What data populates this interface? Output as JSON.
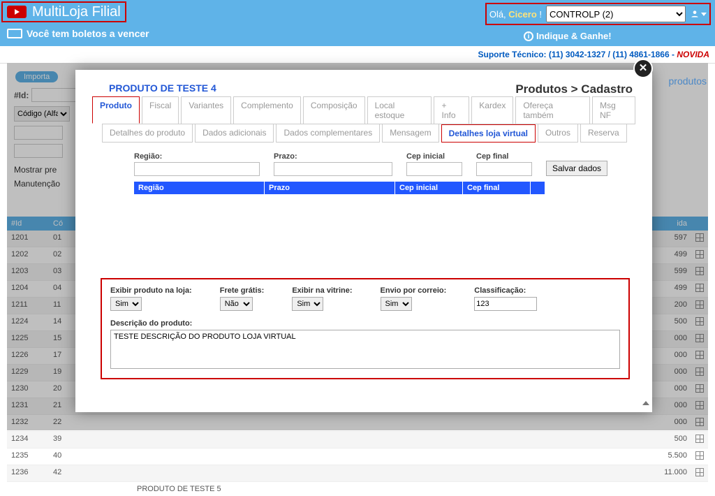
{
  "header": {
    "brand": "MultiLoja Filial",
    "boletos": "Você tem boletos a vencer",
    "greeting_prefix": "Olá, ",
    "greeting_name": "Cicero",
    "greeting_suffix": " !",
    "account_selected": "CONTROLP (2)",
    "indique": "Indique & Ganhe!",
    "support": "Suporte Técnico: (11) 3042-1327 / (11) 4861-1866 - ",
    "novidades": "NOVIDA"
  },
  "bg": {
    "import_btn": "Importa",
    "id_label": "#Id:",
    "codigo_placeholder": "Código (Alfa",
    "mostrar": "Mostrar pre",
    "manutencao": "Manutenção",
    "produtos_tag": "produtos",
    "table_headers": {
      "id": "#Id",
      "cod": "Có",
      "last": "ida"
    },
    "rows": [
      {
        "id": "1201",
        "cod": "01",
        "val": "597"
      },
      {
        "id": "1202",
        "cod": "02",
        "val": "499"
      },
      {
        "id": "1203",
        "cod": "03",
        "val": "599"
      },
      {
        "id": "1204",
        "cod": "04",
        "val": "499"
      },
      {
        "id": "1211",
        "cod": "11",
        "val": "200"
      },
      {
        "id": "1224",
        "cod": "14",
        "val": "500"
      },
      {
        "id": "1225",
        "cod": "15",
        "val": "000"
      },
      {
        "id": "1226",
        "cod": "17",
        "val": "000"
      },
      {
        "id": "1229",
        "cod": "19",
        "val": "000"
      },
      {
        "id": "1230",
        "cod": "20",
        "val": "000"
      },
      {
        "id": "1231",
        "cod": "21",
        "val": "000"
      },
      {
        "id": "1232",
        "cod": "22",
        "val": "000"
      },
      {
        "id": "1234",
        "cod": "39",
        "val": "500"
      },
      {
        "id": "1235",
        "cod": "40",
        "val": "5.500"
      },
      {
        "id": "1236",
        "cod": "42",
        "val": "11.000"
      }
    ],
    "last_prod_label": "PRODUTO DE TESTE 5"
  },
  "modal": {
    "title": "PRODUTO DE TESTE 4",
    "breadcrumb": "Produtos > Cadastro",
    "tabs": [
      "Produto",
      "Fiscal",
      "Variantes",
      "Complemento",
      "Composição",
      "Local estoque",
      "+ Info",
      "Kardex",
      "Ofereça também",
      "Msg NF"
    ],
    "subtabs": [
      "Detalhes do produto",
      "Dados adicionais",
      "Dados complementares",
      "Mensagem",
      "Detalhes loja virtual",
      "Outros",
      "Reserva"
    ],
    "shipping": {
      "regiao_label": "Região:",
      "prazo_label": "Prazo:",
      "cepini_label": "Cep inicial",
      "cepfin_label": "Cep final",
      "save": "Salvar dados",
      "cols": [
        "Região",
        "Prazo",
        "Cep inicial",
        "Cep final",
        ""
      ]
    },
    "red": {
      "exibir_loja_label": "Exibir produto na loja:",
      "exibir_loja_val": "Sim",
      "frete_label": "Frete grátis:",
      "frete_val": "Não",
      "vitrine_label": "Exibir na vitrine:",
      "vitrine_val": "Sim",
      "envio_label": "Envio por correio:",
      "envio_val": "Sim",
      "class_label": "Classificação:",
      "class_val": "123",
      "desc_label": "Descrição do produto:",
      "desc_val": "TESTE DESCRIÇÃO DO PRODUTO LOJA VIRTUAL"
    }
  }
}
